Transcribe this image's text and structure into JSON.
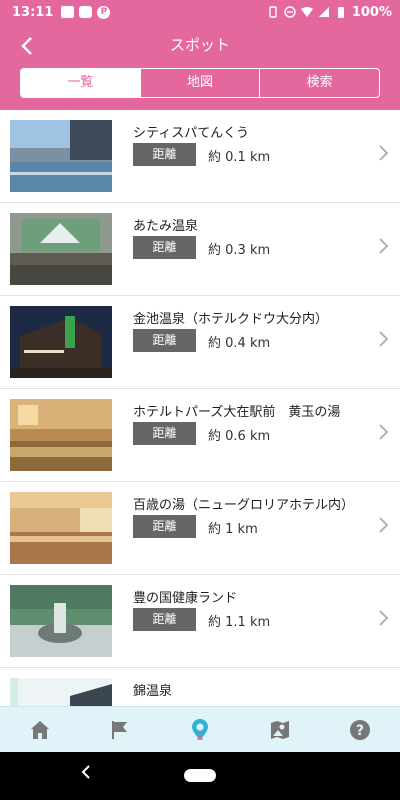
{
  "status_bar": {
    "time": "13:11",
    "battery": "100%"
  },
  "header": {
    "title": "スポット",
    "back_icon": "chevron-left-icon"
  },
  "tabs": [
    {
      "label": "一覧",
      "active": true
    },
    {
      "label": "地図",
      "active": false
    },
    {
      "label": "検索",
      "active": false
    }
  ],
  "distance_label": "距離",
  "spots": [
    {
      "name": "シティスパてんくう",
      "distance": "約 0.1 km"
    },
    {
      "name": "あたみ温泉",
      "distance": "約 0.3 km"
    },
    {
      "name": "金池温泉（ホテルクドウ大分内）",
      "distance": "約 0.4 km"
    },
    {
      "name": "ホテルトパーズ大在駅前　黄玉の湯",
      "distance": "約 0.6 km"
    },
    {
      "name": "百歳の湯（ニューグロリアホテル内）",
      "distance": "約 1 km"
    },
    {
      "name": "豊の国健康ランド",
      "distance": "約 1.1 km"
    },
    {
      "name": "錦温泉",
      "distance": ""
    }
  ],
  "bottom_nav": [
    "home-icon",
    "flag-icon",
    "map-pin-icon",
    "map-icon",
    "help-icon"
  ],
  "colors": {
    "accent": "#e4689e",
    "nav_bg": "#dff3f8",
    "active_nav": "#2fb3d6"
  }
}
